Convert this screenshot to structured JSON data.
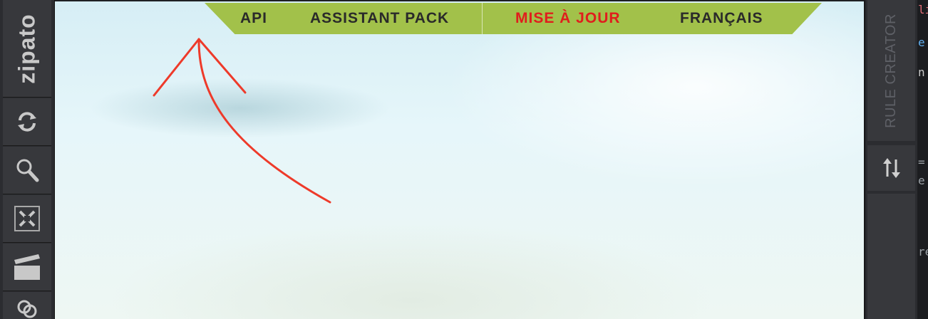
{
  "left_toolbar": {
    "logo": "zipato",
    "tools": [
      {
        "name": "refresh",
        "icon": "refresh-icon"
      },
      {
        "name": "search",
        "icon": "search-icon"
      },
      {
        "name": "fit-to-screen",
        "icon": "fit-screen-icon"
      },
      {
        "name": "scenes",
        "icon": "clapperboard-icon"
      },
      {
        "name": "more",
        "icon": "link-icon"
      }
    ]
  },
  "top_menu": {
    "items": [
      {
        "label": "API"
      },
      {
        "label": "ASSISTANT PACK"
      },
      {
        "label": "MISE À JOUR",
        "highlight": "#e01d1d"
      },
      {
        "label": "FRANÇAIS"
      }
    ]
  },
  "right_toolbar": {
    "rule_creator_label": "RULE CREATOR",
    "sort_icon": "sort-arrows-icon"
  },
  "editor_fragments": [
    "li",
    "e",
    "n",
    "=",
    "e",
    "re"
  ],
  "colors": {
    "menu_bg": "#a2c14a",
    "menu_text": "#2a2a2a",
    "highlight": "#e01d1d",
    "toolbar_bg": "#37383c",
    "annotation": "#ee3a2a"
  }
}
